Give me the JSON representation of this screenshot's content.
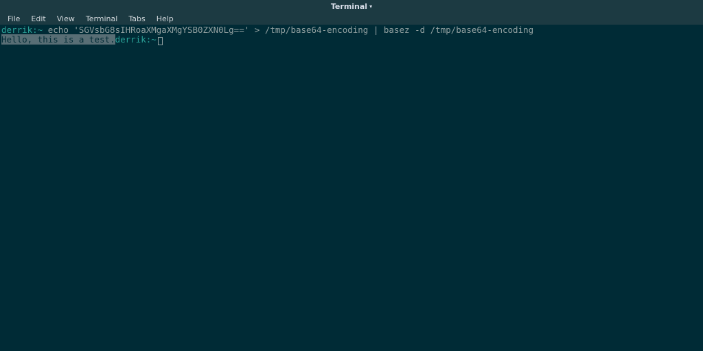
{
  "window": {
    "title": "Terminal"
  },
  "menu": {
    "items": [
      "File",
      "Edit",
      "View",
      "Terminal",
      "Tabs",
      "Help"
    ]
  },
  "terminal": {
    "line1": {
      "prompt": "derrik:~",
      "command": " echo 'SGVsbG8sIHRoaXMgaXMgYSB0ZXN0Lg==' > /tmp/base64-encoding | basez -d /tmp/base64-encoding"
    },
    "line2": {
      "output": "Hello, this is a test.",
      "prompt": "derrik:~"
    }
  }
}
